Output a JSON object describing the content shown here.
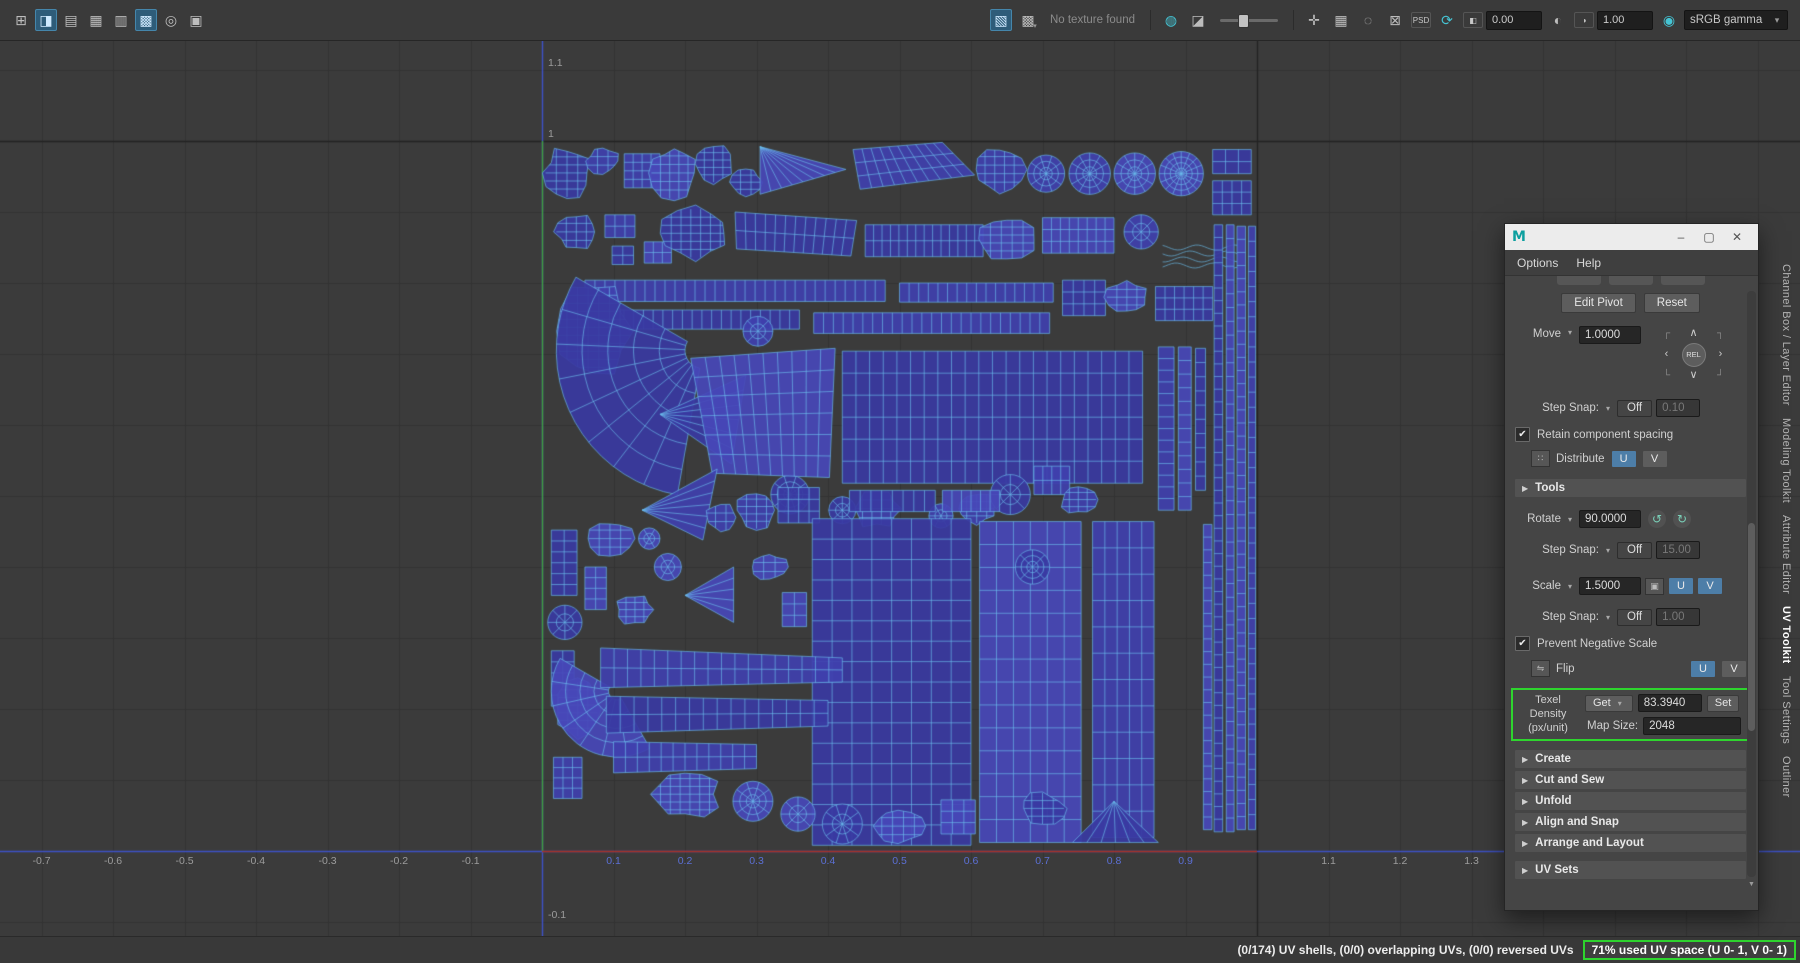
{
  "colors": {
    "accent_blue": "#4d7ea8",
    "uv_fill": "#4040ae",
    "uv_fill_alt": "#3a3aa2",
    "uv_fill_bright": "#4848b8",
    "uv_stroke": "#6cc0ee",
    "axis_blue": "#3d52c8",
    "axis_red": "#a93228",
    "axis_green": "#3f9f3f",
    "grid_minor": "#333333",
    "grid_major": "#232323",
    "highlight_green": "#2ed52e"
  },
  "icons": {
    "dropdown": "▾",
    "collapsed": "▶",
    "check": "✔",
    "rotate_ccw": "↺",
    "rotate_cw": "↻",
    "distribute": "∷",
    "scale_tool": "▣",
    "flip": "⇋",
    "scroll_down": "▼"
  },
  "toolbar": {
    "left_icons": [
      {
        "name": "layout-quad-view-icon",
        "glyph": "⊞"
      },
      {
        "name": "layout-persp-uv-icon",
        "glyph": "◨",
        "active": true
      },
      {
        "name": "uv-texture-image-icon",
        "glyph": "▤"
      },
      {
        "name": "display-grid-icon",
        "glyph": "▦"
      },
      {
        "name": "pixel-snap-icon",
        "glyph": "▥"
      },
      {
        "name": "texture-borders-icon",
        "glyph": "▩",
        "active": true
      },
      {
        "name": "frame-selection-icon",
        "glyph": "◎"
      },
      {
        "name": "uv-snapshot-icon",
        "glyph": "▣"
      }
    ],
    "right_items": [
      {
        "type": "icon",
        "name": "texture-display-icon",
        "glyph": "▧",
        "active": true
      },
      {
        "type": "icon-dd",
        "name": "checker-map-icon",
        "glyph": "▩"
      },
      {
        "type": "label",
        "name": "no-texture-label",
        "text": "No texture found"
      },
      {
        "type": "sep"
      },
      {
        "type": "icon",
        "name": "update-psd-networks-icon",
        "glyph": "◍",
        "teal": true
      },
      {
        "type": "icon",
        "name": "dim-image-icon",
        "glyph": "◪"
      },
      {
        "type": "slider",
        "name": "image-dim-slider"
      },
      {
        "type": "sep"
      },
      {
        "type": "icon",
        "name": "isolate-select-icon",
        "glyph": "✛"
      },
      {
        "type": "icon",
        "name": "view-grid-icon",
        "glyph": "▦"
      },
      {
        "type": "icon",
        "name": "shaded-uvs-icon",
        "glyph": "◌"
      },
      {
        "type": "icon",
        "name": "distortion-display-icon",
        "glyph": "⊠"
      },
      {
        "type": "icon",
        "name": "psd-icon",
        "glyph": "PSD",
        "small": true
      },
      {
        "type": "icon",
        "name": "refresh-image-icon",
        "glyph": "⟳",
        "teal": true
      },
      {
        "type": "field",
        "name": "exposure-field",
        "value": "0.00",
        "icon": "◧"
      },
      {
        "type": "icon",
        "name": "contrast-icon",
        "glyph": "◐"
      },
      {
        "type": "field",
        "name": "gamma-field",
        "value": "1.00",
        "icon": "◑"
      },
      {
        "type": "vt",
        "name": "view-transform-select",
        "icon": "◉",
        "value": "sRGB gamma",
        "arrow": "▾"
      }
    ]
  },
  "viewport": {
    "bottom_axis": [
      "-0.7",
      "-0.6",
      "-0.5",
      "-0.4",
      "-0.3",
      "-0.2",
      "-0.1",
      "0.1",
      "0.2",
      "0.3",
      "0.4",
      "0.5",
      "0.6",
      "0.7",
      "0.8",
      "0.9",
      "1.1",
      "1.2",
      "1.3"
    ],
    "left_axis": [
      {
        "v": 1.1,
        "text": "1.1"
      },
      {
        "v": 1.0,
        "text": "1"
      },
      {
        "v": -0.1,
        "text": "-0.1"
      }
    ]
  },
  "panel": {
    "title_icon": "M",
    "window_buttons": {
      "minimize": "–",
      "maximize": "▢",
      "close": "✕"
    },
    "menus": [
      "Options",
      "Help"
    ],
    "move_pad": {
      "tl": "┌",
      "up": "∧",
      "tr": "┐",
      "left": "‹",
      "center": "REL",
      "right": "›",
      "bl": "└",
      "down": "∨",
      "br": "┘"
    },
    "transform": {
      "edit_pivot": "Edit Pivot",
      "reset": "Reset",
      "move_label": "Move",
      "move_value": "1.0000",
      "step_snap_label": "Step Snap:",
      "move_snap_mode": "Off",
      "move_snap_value": "0.10",
      "retain_label": "Retain component spacing",
      "distribute_label": "Distribute",
      "u_label": "U",
      "v_label": "V",
      "tools_label": "Tools",
      "rotate_label": "Rotate",
      "rotate_value": "90.0000",
      "rotate_snap_mode": "Off",
      "rotate_snap_value": "15.00",
      "scale_label": "Scale",
      "scale_value": "1.5000",
      "scale_snap_mode": "Off",
      "scale_snap_value": "1.00",
      "prevent_label": "Prevent Negative Scale",
      "flip_label": "Flip",
      "texel_label": "Texel Density",
      "texel_unit": "(px/unit)",
      "get_label": "Get",
      "texel_value": "83.3940",
      "set_label": "Set",
      "map_size_label": "Map Size:",
      "map_size_value": "2048"
    },
    "sections": [
      "Create",
      "Cut and Sew",
      "Unfold",
      "Align and Snap",
      "Arrange and Layout",
      "UV Sets"
    ]
  },
  "side_tabs": [
    {
      "label": "Channel Box / Layer Editor"
    },
    {
      "label": "Modeling Toolkit"
    },
    {
      "label": "Attribute Editor"
    },
    {
      "label": "UV Toolkit",
      "active": true
    },
    {
      "label": "Tool Settings"
    },
    {
      "label": "Outliner"
    }
  ],
  "status_bar": {
    "stats": "(0/174) UV shells, (0/0) overlapping UVs, (0/0) reversed UVs",
    "uv_space": "71% used UV space (U 0- 1, V 0- 1)"
  }
}
